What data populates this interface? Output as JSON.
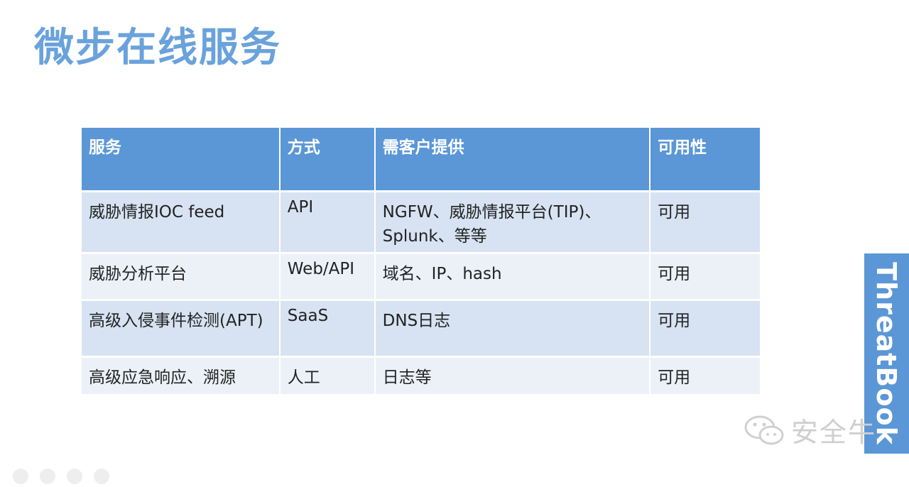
{
  "title": "微步在线服务",
  "table": {
    "headers": [
      "服务",
      "方式",
      "需客户提供",
      "可用性"
    ],
    "rows": [
      [
        "威胁情报IOC feed",
        "API",
        "NGFW、威胁情报平台(TIP)、Splunk、等等",
        "可用"
      ],
      [
        "威胁分析平台",
        "Web/API",
        "域名、IP、hash",
        "可用"
      ],
      [
        "高级入侵事件检测(APT)",
        "SaaS",
        "DNS日志",
        "可用"
      ],
      [
        "高级应急响应、溯源",
        "人工",
        "日志等",
        "可用"
      ]
    ]
  },
  "brand": "ThreatBook",
  "watermark": "安全牛",
  "colors": {
    "title": "#6aa2dc",
    "header_bg": "#5b97d6",
    "row_odd": "#d7e3f2",
    "row_even": "#ecf1f8"
  }
}
